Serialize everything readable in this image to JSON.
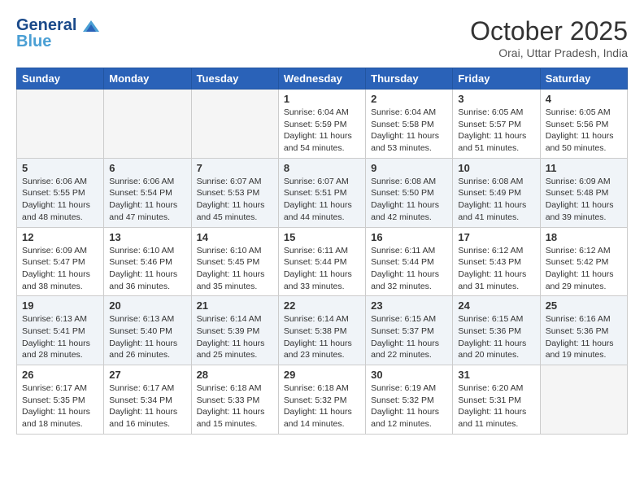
{
  "header": {
    "logo_line1": "General",
    "logo_line2": "Blue",
    "month_year": "October 2025",
    "location": "Orai, Uttar Pradesh, India"
  },
  "weekdays": [
    "Sunday",
    "Monday",
    "Tuesday",
    "Wednesday",
    "Thursday",
    "Friday",
    "Saturday"
  ],
  "weeks": [
    [
      {
        "day": "",
        "empty": true
      },
      {
        "day": "",
        "empty": true
      },
      {
        "day": "",
        "empty": true
      },
      {
        "day": "1",
        "sunrise": "6:04 AM",
        "sunset": "5:59 PM",
        "daylight": "11 hours and 54 minutes."
      },
      {
        "day": "2",
        "sunrise": "6:04 AM",
        "sunset": "5:58 PM",
        "daylight": "11 hours and 53 minutes."
      },
      {
        "day": "3",
        "sunrise": "6:05 AM",
        "sunset": "5:57 PM",
        "daylight": "11 hours and 51 minutes."
      },
      {
        "day": "4",
        "sunrise": "6:05 AM",
        "sunset": "5:56 PM",
        "daylight": "11 hours and 50 minutes."
      }
    ],
    [
      {
        "day": "5",
        "sunrise": "6:06 AM",
        "sunset": "5:55 PM",
        "daylight": "11 hours and 48 minutes."
      },
      {
        "day": "6",
        "sunrise": "6:06 AM",
        "sunset": "5:54 PM",
        "daylight": "11 hours and 47 minutes."
      },
      {
        "day": "7",
        "sunrise": "6:07 AM",
        "sunset": "5:53 PM",
        "daylight": "11 hours and 45 minutes."
      },
      {
        "day": "8",
        "sunrise": "6:07 AM",
        "sunset": "5:51 PM",
        "daylight": "11 hours and 44 minutes."
      },
      {
        "day": "9",
        "sunrise": "6:08 AM",
        "sunset": "5:50 PM",
        "daylight": "11 hours and 42 minutes."
      },
      {
        "day": "10",
        "sunrise": "6:08 AM",
        "sunset": "5:49 PM",
        "daylight": "11 hours and 41 minutes."
      },
      {
        "day": "11",
        "sunrise": "6:09 AM",
        "sunset": "5:48 PM",
        "daylight": "11 hours and 39 minutes."
      }
    ],
    [
      {
        "day": "12",
        "sunrise": "6:09 AM",
        "sunset": "5:47 PM",
        "daylight": "11 hours and 38 minutes."
      },
      {
        "day": "13",
        "sunrise": "6:10 AM",
        "sunset": "5:46 PM",
        "daylight": "11 hours and 36 minutes."
      },
      {
        "day": "14",
        "sunrise": "6:10 AM",
        "sunset": "5:45 PM",
        "daylight": "11 hours and 35 minutes."
      },
      {
        "day": "15",
        "sunrise": "6:11 AM",
        "sunset": "5:44 PM",
        "daylight": "11 hours and 33 minutes."
      },
      {
        "day": "16",
        "sunrise": "6:11 AM",
        "sunset": "5:44 PM",
        "daylight": "11 hours and 32 minutes."
      },
      {
        "day": "17",
        "sunrise": "6:12 AM",
        "sunset": "5:43 PM",
        "daylight": "11 hours and 31 minutes."
      },
      {
        "day": "18",
        "sunrise": "6:12 AM",
        "sunset": "5:42 PM",
        "daylight": "11 hours and 29 minutes."
      }
    ],
    [
      {
        "day": "19",
        "sunrise": "6:13 AM",
        "sunset": "5:41 PM",
        "daylight": "11 hours and 28 minutes."
      },
      {
        "day": "20",
        "sunrise": "6:13 AM",
        "sunset": "5:40 PM",
        "daylight": "11 hours and 26 minutes."
      },
      {
        "day": "21",
        "sunrise": "6:14 AM",
        "sunset": "5:39 PM",
        "daylight": "11 hours and 25 minutes."
      },
      {
        "day": "22",
        "sunrise": "6:14 AM",
        "sunset": "5:38 PM",
        "daylight": "11 hours and 23 minutes."
      },
      {
        "day": "23",
        "sunrise": "6:15 AM",
        "sunset": "5:37 PM",
        "daylight": "11 hours and 22 minutes."
      },
      {
        "day": "24",
        "sunrise": "6:15 AM",
        "sunset": "5:36 PM",
        "daylight": "11 hours and 20 minutes."
      },
      {
        "day": "25",
        "sunrise": "6:16 AM",
        "sunset": "5:36 PM",
        "daylight": "11 hours and 19 minutes."
      }
    ],
    [
      {
        "day": "26",
        "sunrise": "6:17 AM",
        "sunset": "5:35 PM",
        "daylight": "11 hours and 18 minutes."
      },
      {
        "day": "27",
        "sunrise": "6:17 AM",
        "sunset": "5:34 PM",
        "daylight": "11 hours and 16 minutes."
      },
      {
        "day": "28",
        "sunrise": "6:18 AM",
        "sunset": "5:33 PM",
        "daylight": "11 hours and 15 minutes."
      },
      {
        "day": "29",
        "sunrise": "6:18 AM",
        "sunset": "5:32 PM",
        "daylight": "11 hours and 14 minutes."
      },
      {
        "day": "30",
        "sunrise": "6:19 AM",
        "sunset": "5:32 PM",
        "daylight": "11 hours and 12 minutes."
      },
      {
        "day": "31",
        "sunrise": "6:20 AM",
        "sunset": "5:31 PM",
        "daylight": "11 hours and 11 minutes."
      },
      {
        "day": "",
        "empty": true
      }
    ]
  ],
  "labels": {
    "sunrise": "Sunrise:",
    "sunset": "Sunset:",
    "daylight": "Daylight:"
  }
}
